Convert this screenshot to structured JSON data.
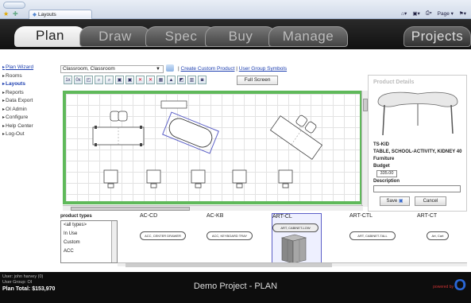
{
  "browser": {
    "nav_hint": "",
    "tab_title": "Layouts",
    "tools": [
      "Page ▾"
    ]
  },
  "main_nav": {
    "tabs": [
      "Plan",
      "Draw",
      "Spec",
      "Buy",
      "Manage"
    ],
    "active_tab": "Plan",
    "right_tab": "Projects"
  },
  "sidebar": {
    "items": [
      "Plan Wizard",
      "Rooms",
      "Layouts",
      "Reports",
      "Data Export",
      "OI Admin",
      "Configure",
      "Help Center",
      "Log-Out"
    ]
  },
  "toolbar": {
    "room_select": "Classroom, Classroom",
    "separator": "|",
    "create_custom": "Create Custom Product",
    "user_group_symbols": "User Group Symbols",
    "full_screen": "Full Screen",
    "tools": [
      "1x",
      "0x",
      "◰",
      "⌕",
      "⌕",
      "▣",
      "▣",
      "✕",
      "✕",
      "▦",
      "▲",
      "◩",
      "▥",
      "◙"
    ]
  },
  "product_details": {
    "title": "Product Details",
    "code": "TS-KID",
    "name": "TABLE, SCHOOL-ACTIVITY, KIDNEY 40",
    "category": "Furniture",
    "budget_label": "Budget",
    "budget_value": "335.00",
    "description_label": "Description",
    "save_label": "Save",
    "cancel_label": "Cancel"
  },
  "product_types": {
    "header": "product types",
    "items": [
      "<all types>",
      "In Use",
      "Custom",
      "ACC"
    ]
  },
  "products": [
    {
      "code": "AC-CD",
      "label": "ACC, CENTER DRAWER",
      "selected": false
    },
    {
      "code": "AC-KB",
      "label": "ACC, KEYBOARD TRAY",
      "selected": false
    },
    {
      "code": "ART-CL",
      "label": "ART, CABINET-LOW",
      "selected": true
    },
    {
      "code": "ART-CTL",
      "label": "ART, CABINET-TALL",
      "selected": false
    },
    {
      "code": "ART-CT",
      "label": "Art, Cart",
      "selected": false
    }
  ],
  "footer": {
    "user": "User: john harvey (0)",
    "group": "User Group: OI",
    "plan_total": "Plan Total: $153,970",
    "project": "Demo Project - PLAN",
    "powered_by": "powered by",
    "logo": "O"
  },
  "colors": {
    "canvas_border": "#5fb95a",
    "footer_bg": "#0d0d0d",
    "link": "#1d3fb0",
    "selection": "#5b5fc7"
  }
}
